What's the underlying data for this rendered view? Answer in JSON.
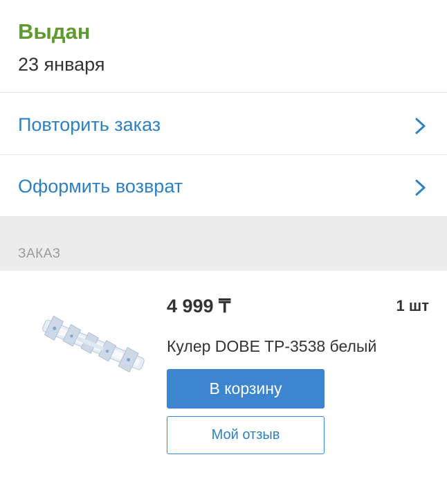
{
  "status": {
    "title": "Выдан",
    "date": "23 января"
  },
  "actions": [
    {
      "label": "Повторить заказ",
      "icon": "chevron-right-icon"
    },
    {
      "label": "Оформить возврат",
      "icon": "chevron-right-icon"
    }
  ],
  "order_section": {
    "label": "ЗАКАЗ"
  },
  "product": {
    "price": "4 999 ₸",
    "quantity": "1 шт",
    "name": "Кулер DOBE TP-3538 белый",
    "image_icon": "cooler-product-image",
    "add_to_cart_label": "В корзину",
    "review_label": "Мой отзыв"
  },
  "colors": {
    "status_green": "#5f9a2e",
    "link_blue": "#2f7fc1",
    "button_blue": "#3d86cf",
    "section_gray": "#ececec"
  }
}
